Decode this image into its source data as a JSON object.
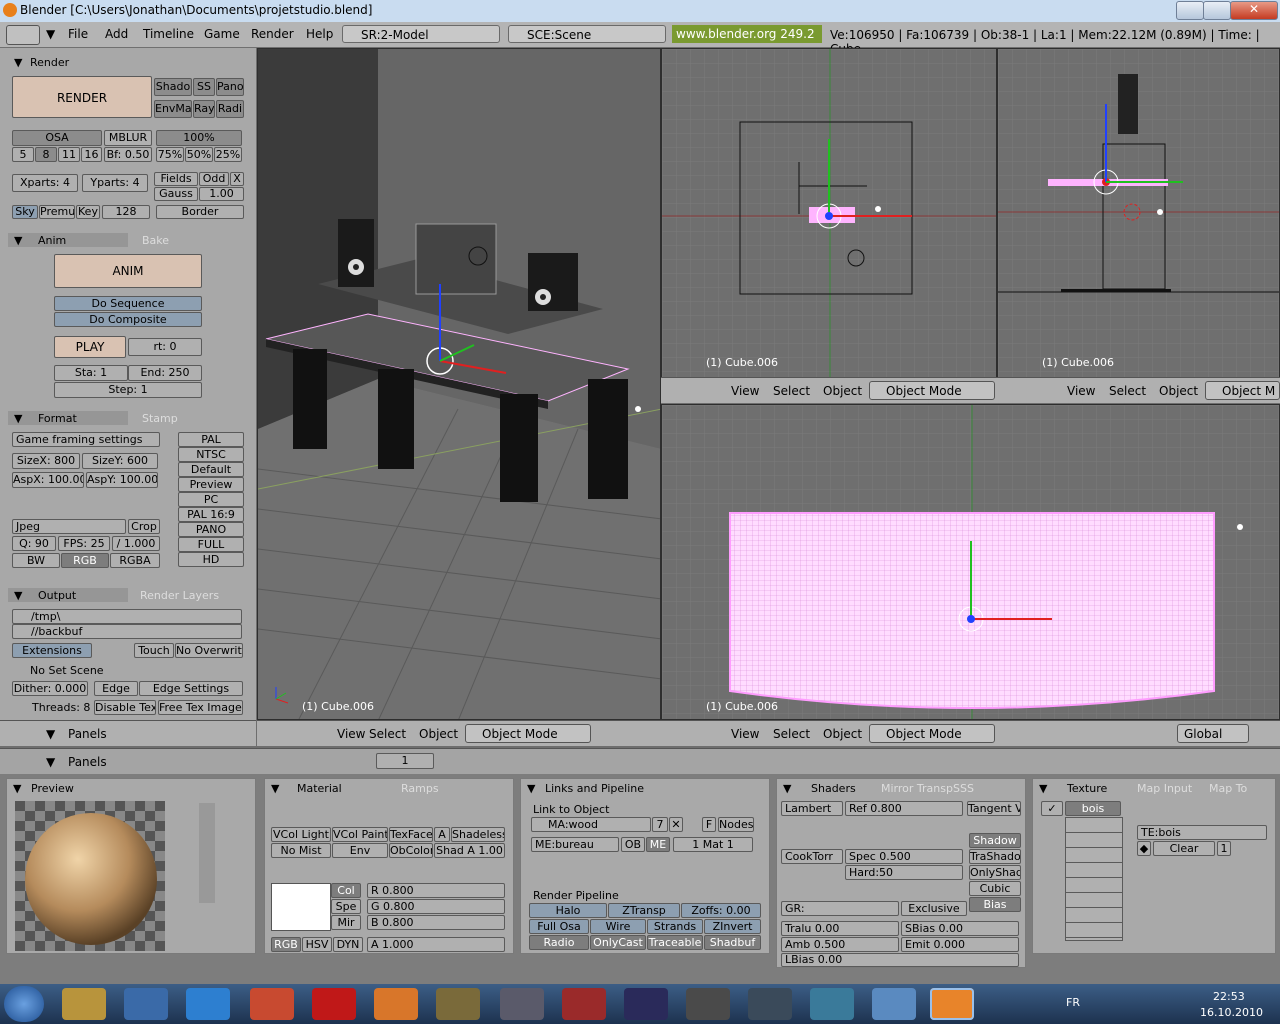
{
  "window": {
    "title": "Blender [C:\\Users\\Jonathan\\Documents\\projetstudio.blend]"
  },
  "menubar": {
    "items": [
      "File",
      "Add",
      "Timeline",
      "Game",
      "Render",
      "Help"
    ],
    "screen": "SR:2-Model",
    "scene": "SCE:Scene",
    "site": "www.blender.org 249.2",
    "stats": "Ve:106950 | Fa:106739 | Ob:38-1 | La:1 | Mem:22.12M (0.89M) | Time: | Cube"
  },
  "render_panel": {
    "render_tab": "Render",
    "render_button": "RENDER",
    "shado": "Shado",
    "ss": "SS",
    "pano": "Pano",
    "envma": "EnvMa",
    "ray": "Ray",
    "radi": "Radi",
    "osa": "OSA",
    "mblur": "MBLUR",
    "pct100": "100%",
    "osa_vals": [
      "5",
      "8",
      "11",
      "16"
    ],
    "bf": "Bf: 0.50",
    "pcts": [
      "75%",
      "50%",
      "25%"
    ],
    "xparts": "Xparts: 4",
    "yparts": "Yparts: 4",
    "fields": "Fields",
    "odd": "Odd",
    "x": "X",
    "gauss": "Gauss",
    "gauss_val": "1.00",
    "sky": "Sky",
    "premul": "Premul",
    "key": "Key",
    "key_val": "128",
    "border": "Border"
  },
  "anim_panel": {
    "tab": "Anim",
    "tab2": "Bake",
    "anim_button": "ANIM",
    "do_sequence": "Do Sequence",
    "do_composite": "Do Composite",
    "play": "PLAY",
    "rt": "rt: 0",
    "sta": "Sta: 1",
    "end": "End: 250",
    "step": "Step: 1"
  },
  "format_panel": {
    "tab": "Format",
    "tab2": "Stamp",
    "game_framing": "Game framing settings",
    "sizex": "SizeX: 800",
    "sizey": "SizeY: 600",
    "aspx": "AspX: 100.00",
    "aspy": "AspY: 100.00",
    "presets": [
      "PAL",
      "NTSC",
      "Default",
      "Preview",
      "PC",
      "PAL 16:9",
      "PANO",
      "FULL",
      "HD"
    ],
    "jpeg": "Jpeg",
    "crop": "Crop",
    "q": "Q: 90",
    "fps": "FPS: 25",
    "fps_div": "/ 1.000",
    "bw": "BW",
    "rgb": "RGB",
    "rgba": "RGBA"
  },
  "output_panel": {
    "tab": "Output",
    "tab2": "Render Layers",
    "path1": "/tmp\\",
    "path2": "//backbuf",
    "extensions": "Extensions",
    "touch": "Touch",
    "no_overwrite": "No Overwrite",
    "no_set_scene": "No Set Scene",
    "dither": "Dither: 0.000",
    "edge": "Edge",
    "edge_settings": "Edge Settings",
    "threads": "Threads: 8",
    "disable_tex": "Disable Tex",
    "free_tex": "Free Tex Images"
  },
  "viewports": {
    "object_label": "(1) Cube.006",
    "view": "View",
    "select": "Select",
    "object": "Object",
    "mode": "Object Mode",
    "mode_short": "Object M",
    "global": "Global"
  },
  "buttons_header": {
    "panels": "Panels",
    "frame": "1"
  },
  "preview": {
    "title": "Preview"
  },
  "material": {
    "tab": "Material",
    "tab2": "Ramps",
    "vcol_light": "VCol Light",
    "vcol_paint": "VCol Paint",
    "texface": "TexFace",
    "a": "A",
    "shadeless": "Shadeless",
    "no_mist": "No Mist",
    "env": "Env",
    "obcolor": "ObColor",
    "shad_a": "Shad A 1.00",
    "col": "Col",
    "spe": "Spe",
    "mir": "Mir",
    "r": "R 0.800",
    "g": "G 0.800",
    "b": "B 0.800",
    "rgb": "RGB",
    "hsv": "HSV",
    "dyn": "DYN",
    "alpha": "A 1.000"
  },
  "links": {
    "tab": "Links and Pipeline",
    "link_to_object": "Link to Object",
    "ma": "MA:wood",
    "ma_users": "7",
    "f": "F",
    "nodes": "Nodes",
    "me": "ME:bureau",
    "ob": "OB",
    "me_btn": "ME",
    "mat": "1 Mat 1",
    "render_pipeline": "Render Pipeline",
    "halo": "Halo",
    "ztransp": "ZTransp",
    "zoffs": "Zoffs: 0.00",
    "full_osa": "Full Osa",
    "wire": "Wire",
    "strands": "Strands",
    "zinvert": "ZInvert",
    "radio": "Radio",
    "onlycast": "OnlyCast",
    "traceable": "Traceable",
    "shadbuf": "Shadbuf"
  },
  "shaders": {
    "tab": "Shaders",
    "tab2": "Mirror Transp",
    "tab3": "SSS",
    "lambert": "Lambert",
    "ref": "Ref  0.800",
    "tangent": "Tangent V",
    "cooktorr": "CookTorr",
    "spec": "Spec 0.500",
    "hard": "Hard:50",
    "shadow": "Shadow",
    "trashado": "TraShado",
    "onlyshad": "OnlyShad",
    "cubic": "Cubic",
    "bias": "Bias",
    "gr": "GR:",
    "exclusive": "Exclusive",
    "tralu": "Tralu 0.00",
    "sbias": "SBias 0.00",
    "amb": "Amb 0.500",
    "emit": "Emit 0.000",
    "lbias": "LBias 0.00"
  },
  "texture": {
    "tab": "Texture",
    "tab2": "Map Input",
    "tab3": "Map To",
    "slot": "bois",
    "te": "TE:bois",
    "clear": "Clear",
    "users": "1"
  },
  "taskbar": {
    "lang": "FR",
    "time": "22:53",
    "date": "16.10.2010"
  },
  "colors": {
    "accent_green": "#7a9a30",
    "selection_pink": "#ffb4ff",
    "panel": "#a8a8a8"
  }
}
